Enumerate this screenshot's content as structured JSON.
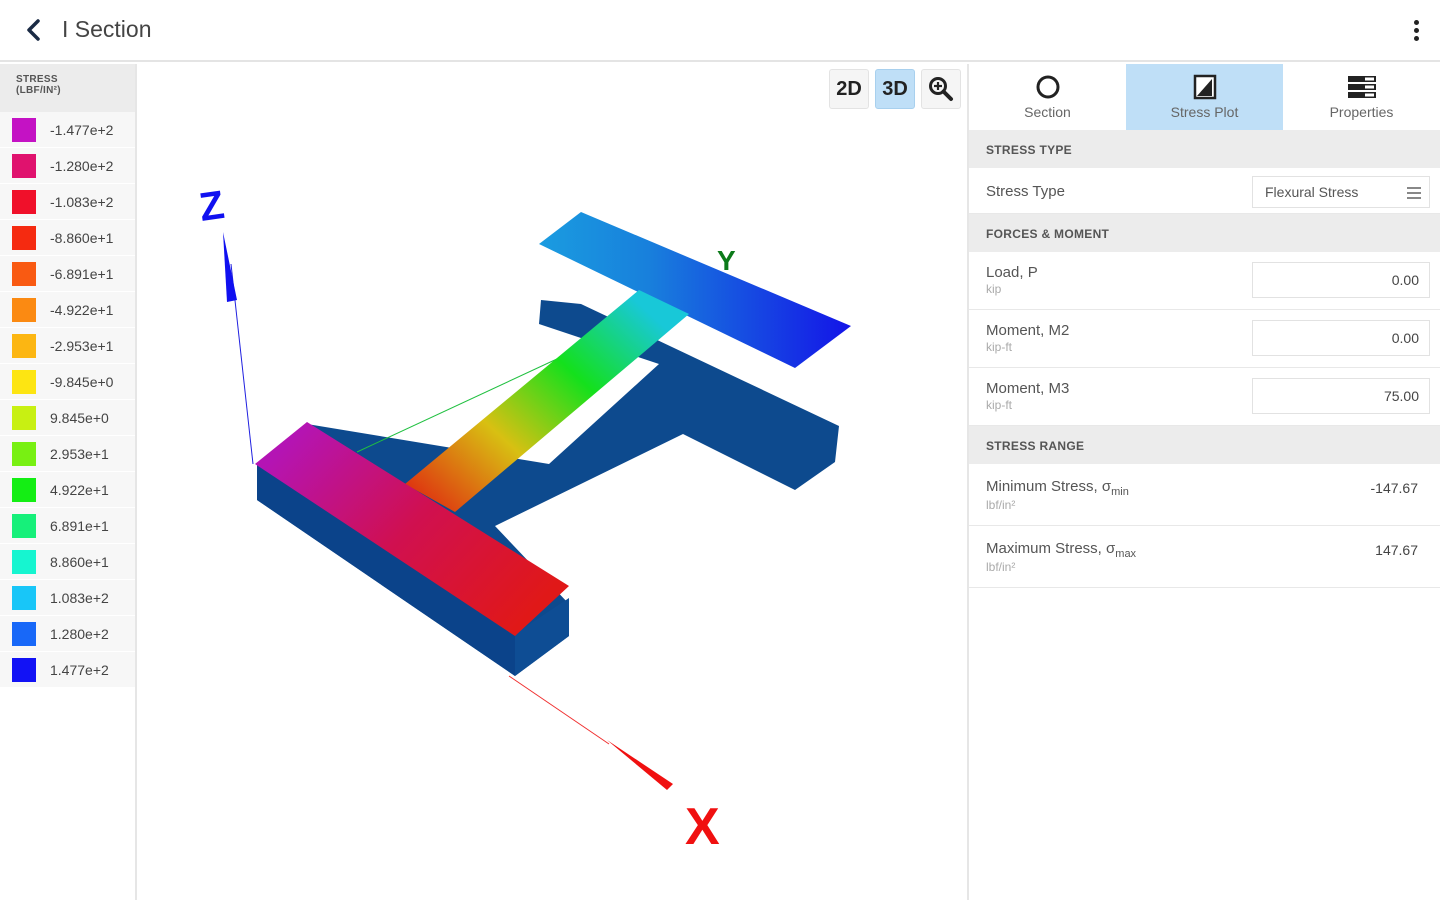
{
  "header": {
    "title": "I Section"
  },
  "legend": {
    "title_line1": "STRESS",
    "title_line2": "(LBF/IN²)",
    "items": [
      {
        "label": "-1.477e+2",
        "color": "#c412c4"
      },
      {
        "label": "-1.280e+2",
        "color": "#e0126e"
      },
      {
        "label": "-1.083e+2",
        "color": "#f0102a"
      },
      {
        "label": "-8.860e+1",
        "color": "#f52a10"
      },
      {
        "label": "-6.891e+1",
        "color": "#f95a12"
      },
      {
        "label": "-4.922e+1",
        "color": "#fb8a12"
      },
      {
        "label": "-2.953e+1",
        "color": "#fcb612"
      },
      {
        "label": "-9.845e+0",
        "color": "#fde512"
      },
      {
        "label": "9.845e+0",
        "color": "#c8f012"
      },
      {
        "label": "2.953e+1",
        "color": "#78f012"
      },
      {
        "label": "4.922e+1",
        "color": "#14ee14"
      },
      {
        "label": "6.891e+1",
        "color": "#16f07a"
      },
      {
        "label": "8.860e+1",
        "color": "#16f5d0"
      },
      {
        "label": "1.083e+2",
        "color": "#18c6f8"
      },
      {
        "label": "1.280e+2",
        "color": "#1868f8"
      },
      {
        "label": "1.477e+2",
        "color": "#1212f5"
      }
    ]
  },
  "view": {
    "btn_2d": "2D",
    "btn_3d": "3D",
    "active_mode": "3D",
    "axis_x": "X",
    "axis_y": "Y",
    "axis_z": "Z"
  },
  "panel": {
    "tabs": [
      {
        "label": "Section",
        "icon": "circle-icon"
      },
      {
        "label": "Stress Plot",
        "icon": "stress-plot-icon",
        "active": true
      },
      {
        "label": "Properties",
        "icon": "properties-icon"
      }
    ],
    "stress_type_header": "STRESS TYPE",
    "stress_type_label": "Stress Type",
    "stress_type_value": "Flexural Stress",
    "forces_header": "FORCES & MOMENT",
    "load_label": "Load, P",
    "load_unit": "kip",
    "load_value": "0.00",
    "m2_label": "Moment, M2",
    "m2_unit": "kip-ft",
    "m2_value": "0.00",
    "m3_label": "Moment, M3",
    "m3_unit": "kip-ft",
    "m3_value": "75.00",
    "range_header": "STRESS RANGE",
    "min_label": "Minimum Stress, σ",
    "min_sub": "min",
    "min_unit": "lbf/in²",
    "min_value": "-147.67",
    "max_label": "Maximum Stress, σ",
    "max_sub": "max",
    "max_unit": "lbf/in²",
    "max_value": "147.67"
  }
}
